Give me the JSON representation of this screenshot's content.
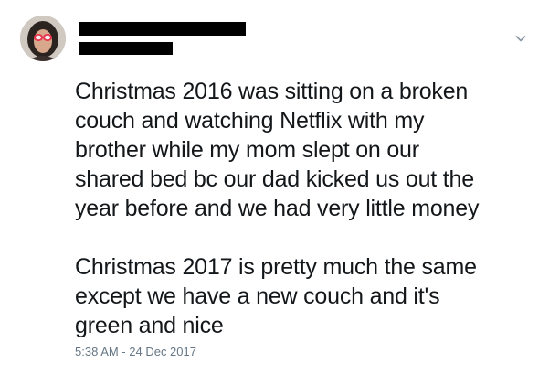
{
  "tweet": {
    "avatar_icon": "user-avatar-photo",
    "menu_icon": "chevron-down-icon",
    "paragraphs": [
      [
        "Christmas 2016 was sitting on a broken",
        "couch and watching Netflix with my",
        "brother while my mom slept on our",
        "shared bed bc our dad kicked us out the",
        "year before and we had very little money"
      ],
      [
        "Christmas 2017 is pretty much the same",
        "except we have a new couch and it's",
        "green and nice"
      ]
    ],
    "timestamp": "5:38 AM - 24 Dec 2017"
  },
  "colors": {
    "text": "#14171a",
    "secondary_text": "#657786",
    "redaction": "#000000"
  }
}
